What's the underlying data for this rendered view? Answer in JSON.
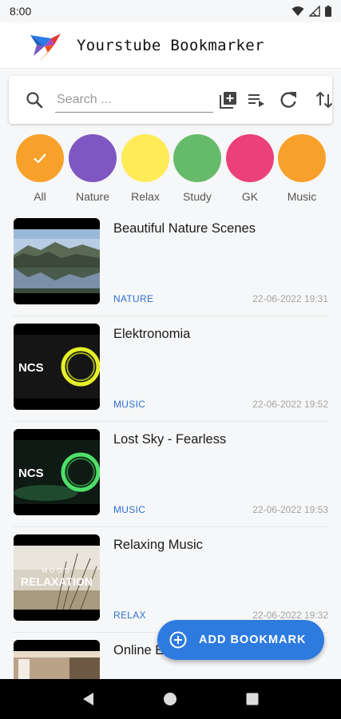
{
  "status_bar": {
    "time": "8:00"
  },
  "app": {
    "title": "Yourstube Bookmarker"
  },
  "search": {
    "placeholder": "Search ..."
  },
  "toolbar": {
    "icons": [
      "add-box-icon",
      "playlist-icon",
      "refresh-icon",
      "sort-icon"
    ]
  },
  "categories": [
    {
      "label": "All",
      "color": "#f7a12b",
      "selected": true
    },
    {
      "label": "Nature",
      "color": "#7e57c2",
      "selected": false
    },
    {
      "label": "Relax",
      "color": "#ffeb57",
      "selected": false
    },
    {
      "label": "Study",
      "color": "#66bb6a",
      "selected": false
    },
    {
      "label": "GK",
      "color": "#ec407a",
      "selected": false
    },
    {
      "label": "Music",
      "color": "#f7a12b",
      "selected": false
    }
  ],
  "bookmarks": [
    {
      "title": "Beautiful Nature Scenes",
      "category": "NATURE",
      "date": "22-06-2022 19:31"
    },
    {
      "title": "Elektronomia",
      "category": "MUSIC",
      "date": "22-06-2022 19:52"
    },
    {
      "title": "Lost Sky - Fearless",
      "category": "MUSIC",
      "date": "22-06-2022 19:53"
    },
    {
      "title": "Relaxing Music",
      "category": "RELAX",
      "date": "22-06-2022 19:32"
    },
    {
      "title": "Online E",
      "category": "",
      "date": ""
    }
  ],
  "thumb_text": {
    "ncs": "NCS",
    "mood": "MOOD",
    "relaxation": "RELAXATION"
  },
  "fab": {
    "label": "ADD BOOKMARK"
  },
  "colors": {
    "accent": "#2e7be0",
    "category_text": "#2d6fd4"
  }
}
